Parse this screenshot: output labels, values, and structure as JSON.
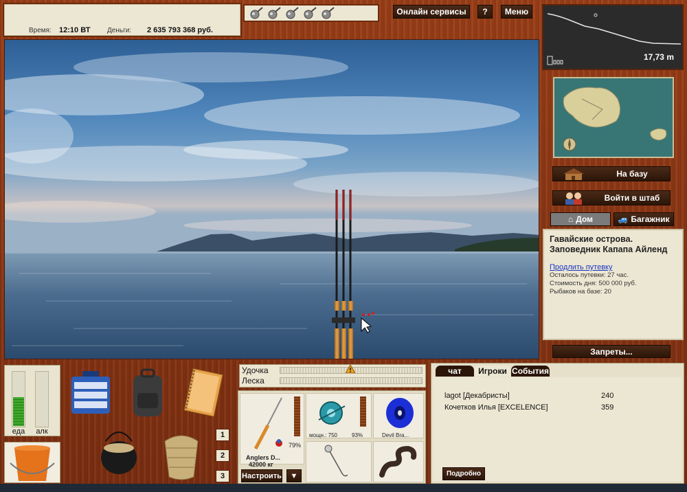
{
  "info": {
    "time_label": "Время:",
    "time_value": "12:10 ВТ",
    "money_label": "Деньги:",
    "money_value": "2 635 793 368 руб."
  },
  "top_buttons": {
    "online": "Онлайн сервисы",
    "help": "?",
    "menu": "Меню"
  },
  "depth": {
    "value": "17,73 m"
  },
  "side": {
    "to_base": "На базу",
    "to_hq": "Войти в штаб",
    "home": "Дом",
    "trunk": "Багажник",
    "bans": "Запреты..."
  },
  "location": {
    "title": "Гавайские острова. Заповедник Капапа Айленд",
    "extend_link": "Продлить путевку",
    "lines": [
      "Осталось путевки: 27 час.",
      "Стоимость дня: 500 000 руб.",
      "Рыбаков на базе: 20"
    ]
  },
  "meters": {
    "food_label": "еда",
    "food_level": 0.52,
    "alc_label": "алк",
    "alc_level": 0.0
  },
  "slots": [
    "1",
    "2",
    "3"
  ],
  "tension": {
    "rod_label": "Удочка",
    "line_label": "Леска",
    "rod_level": 0.0,
    "line_level": 0.0,
    "marker_position": 0.49
  },
  "gear": {
    "rod_name": "Anglers D...",
    "rod_weight": "42000 кг",
    "rod_percent": "79%",
    "reel_power": "мощн.: 750",
    "reel_percent": "93%",
    "line_name": "Devil Bra...",
    "configure_label": "Настроить",
    "dropdown_label": "▼"
  },
  "chat": {
    "tabs": [
      "чат",
      "Игроки",
      "События"
    ],
    "active_tab": 1,
    "players": [
      {
        "name": "lagot [Декабристы]",
        "score": "240"
      },
      {
        "name": "Кочетков Илья [EXCELENCE]",
        "score": "359"
      }
    ],
    "details_label": "Подробно"
  },
  "colors": {
    "wood": "#9a3e17",
    "panel": "#ece7d3",
    "button_dark": "#2b1508",
    "link": "#1a35c2"
  }
}
